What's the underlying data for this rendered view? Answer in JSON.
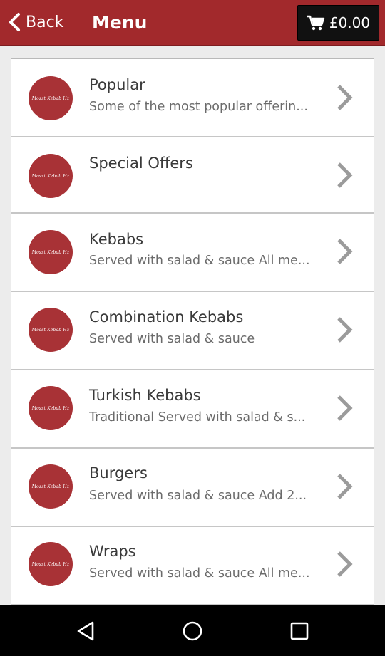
{
  "header": {
    "back_label": "Back",
    "title": "Menu",
    "cart_total": "£0.00"
  },
  "logo_text": "Mosst Kebab Hz",
  "menu": {
    "items": [
      {
        "name": "Popular",
        "desc": "Some of the most popular offerin..."
      },
      {
        "name": "Special Offers",
        "desc": ""
      },
      {
        "name": "Kebabs",
        "desc": "Served with salad & sauce All me..."
      },
      {
        "name": "Combination Kebabs",
        "desc": "Served with salad & sauce"
      },
      {
        "name": "Turkish Kebabs",
        "desc": "Traditional Served with salad & s..."
      },
      {
        "name": "Burgers",
        "desc": "Served with salad & sauce Add 2..."
      },
      {
        "name": "Wraps",
        "desc": "Served with salad & sauce All me..."
      }
    ]
  },
  "colors": {
    "header_bg": "#a2292c",
    "cart_bg": "#111111",
    "logo_bg": "#a83236",
    "nav_bg": "#000000"
  },
  "icons": {
    "back": "chevron-left-icon",
    "cart": "shopping-cart-icon",
    "row_arrow": "chevron-right-icon",
    "nav_back": "triangle-back-icon",
    "nav_home": "circle-home-icon",
    "nav_recents": "square-recents-icon"
  }
}
